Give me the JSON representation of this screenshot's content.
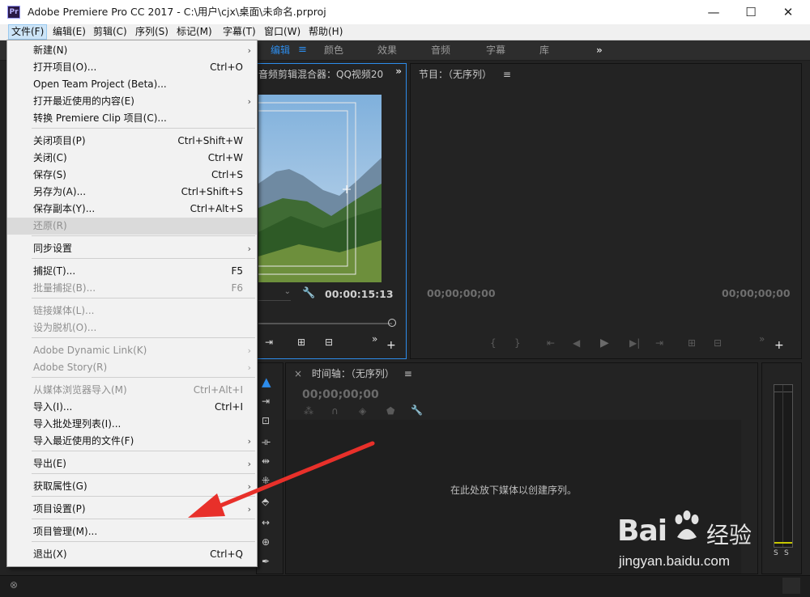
{
  "window": {
    "app_icon": "Pr",
    "title": "Adobe Premiere Pro CC 2017 - C:\\用户\\cjx\\桌面\\未命名.prproj",
    "minimize": "—",
    "maximize": "☐",
    "close": "✕"
  },
  "menubar": [
    "文件(F)",
    "编辑(E)",
    "剪辑(C)",
    "序列(S)",
    "标记(M)",
    "字幕(T)",
    "窗口(W)",
    "帮助(H)"
  ],
  "workspace": {
    "tabs": [
      "编辑",
      "颜色",
      "效果",
      "音频",
      "字幕",
      "库"
    ],
    "active_tab": "编辑",
    "more": "»"
  },
  "source_panel": {
    "title": "音频剪辑混合器：QQ视频20",
    "timecode": "00:00:15:13"
  },
  "program_panel": {
    "title": "节目：（无序列）",
    "timecode_left": "00;00;00;00",
    "timecode_right": "00;00;00;00"
  },
  "timeline_panel": {
    "title": "时间轴：（无序列）",
    "timecode": "00;00;00;00",
    "empty_hint": "在此处放下媒体以创建序列。"
  },
  "audio_meter": {
    "left_label": "S",
    "right_label": "S"
  },
  "file_menu": {
    "items": [
      {
        "label": "新建(N)",
        "shortcut": "",
        "submenu": true,
        "disabled": false
      },
      {
        "label": "打开项目(O)...",
        "shortcut": "Ctrl+O",
        "submenu": false,
        "disabled": false
      },
      {
        "label": "Open Team Project (Beta)...",
        "shortcut": "",
        "submenu": false,
        "disabled": false
      },
      {
        "label": "打开最近使用的内容(E)",
        "shortcut": "",
        "submenu": true,
        "disabled": false
      },
      {
        "label": "转换 Premiere Clip 项目(C)...",
        "shortcut": "",
        "submenu": false,
        "disabled": false
      },
      {
        "label": "关闭项目(P)",
        "shortcut": "Ctrl+Shift+W",
        "submenu": false,
        "disabled": false
      },
      {
        "label": "关闭(C)",
        "shortcut": "Ctrl+W",
        "submenu": false,
        "disabled": false
      },
      {
        "label": "保存(S)",
        "shortcut": "Ctrl+S",
        "submenu": false,
        "disabled": false
      },
      {
        "label": "另存为(A)...",
        "shortcut": "Ctrl+Shift+S",
        "submenu": false,
        "disabled": false
      },
      {
        "label": "保存副本(Y)...",
        "shortcut": "Ctrl+Alt+S",
        "submenu": false,
        "disabled": false
      },
      {
        "label": "还原(R)",
        "shortcut": "",
        "submenu": false,
        "disabled": true
      },
      {
        "label": "同步设置",
        "shortcut": "",
        "submenu": true,
        "disabled": false
      },
      {
        "label": "捕捉(T)...",
        "shortcut": "F5",
        "submenu": false,
        "disabled": false
      },
      {
        "label": "批量捕捉(B)...",
        "shortcut": "F6",
        "submenu": false,
        "disabled": true
      },
      {
        "label": "链接媒体(L)...",
        "shortcut": "",
        "submenu": false,
        "disabled": true
      },
      {
        "label": "设为脱机(O)...",
        "shortcut": "",
        "submenu": false,
        "disabled": true
      },
      {
        "label": "Adobe Dynamic Link(K)",
        "shortcut": "",
        "submenu": true,
        "disabled": true
      },
      {
        "label": "Adobe Story(R)",
        "shortcut": "",
        "submenu": true,
        "disabled": true
      },
      {
        "label": "从媒体浏览器导入(M)",
        "shortcut": "Ctrl+Alt+I",
        "submenu": false,
        "disabled": true
      },
      {
        "label": "导入(I)...",
        "shortcut": "Ctrl+I",
        "submenu": false,
        "disabled": false
      },
      {
        "label": "导入批处理列表(I)...",
        "shortcut": "",
        "submenu": false,
        "disabled": false
      },
      {
        "label": "导入最近使用的文件(F)",
        "shortcut": "",
        "submenu": true,
        "disabled": false
      },
      {
        "label": "导出(E)",
        "shortcut": "",
        "submenu": true,
        "disabled": false
      },
      {
        "label": "获取属性(G)",
        "shortcut": "",
        "submenu": true,
        "disabled": false
      },
      {
        "label": "项目设置(P)",
        "shortcut": "",
        "submenu": true,
        "disabled": false
      },
      {
        "label": "项目管理(M)...",
        "shortcut": "",
        "submenu": false,
        "disabled": false
      },
      {
        "label": "退出(X)",
        "shortcut": "Ctrl+Q",
        "submenu": false,
        "disabled": false
      }
    ]
  },
  "watermark": {
    "brand": "Bai",
    "brand_suffix": "经验",
    "url": "jingyan.baidu.com"
  },
  "colors": {
    "accent_blue": "#2d8ceb",
    "annotation_red": "#e8302a"
  }
}
